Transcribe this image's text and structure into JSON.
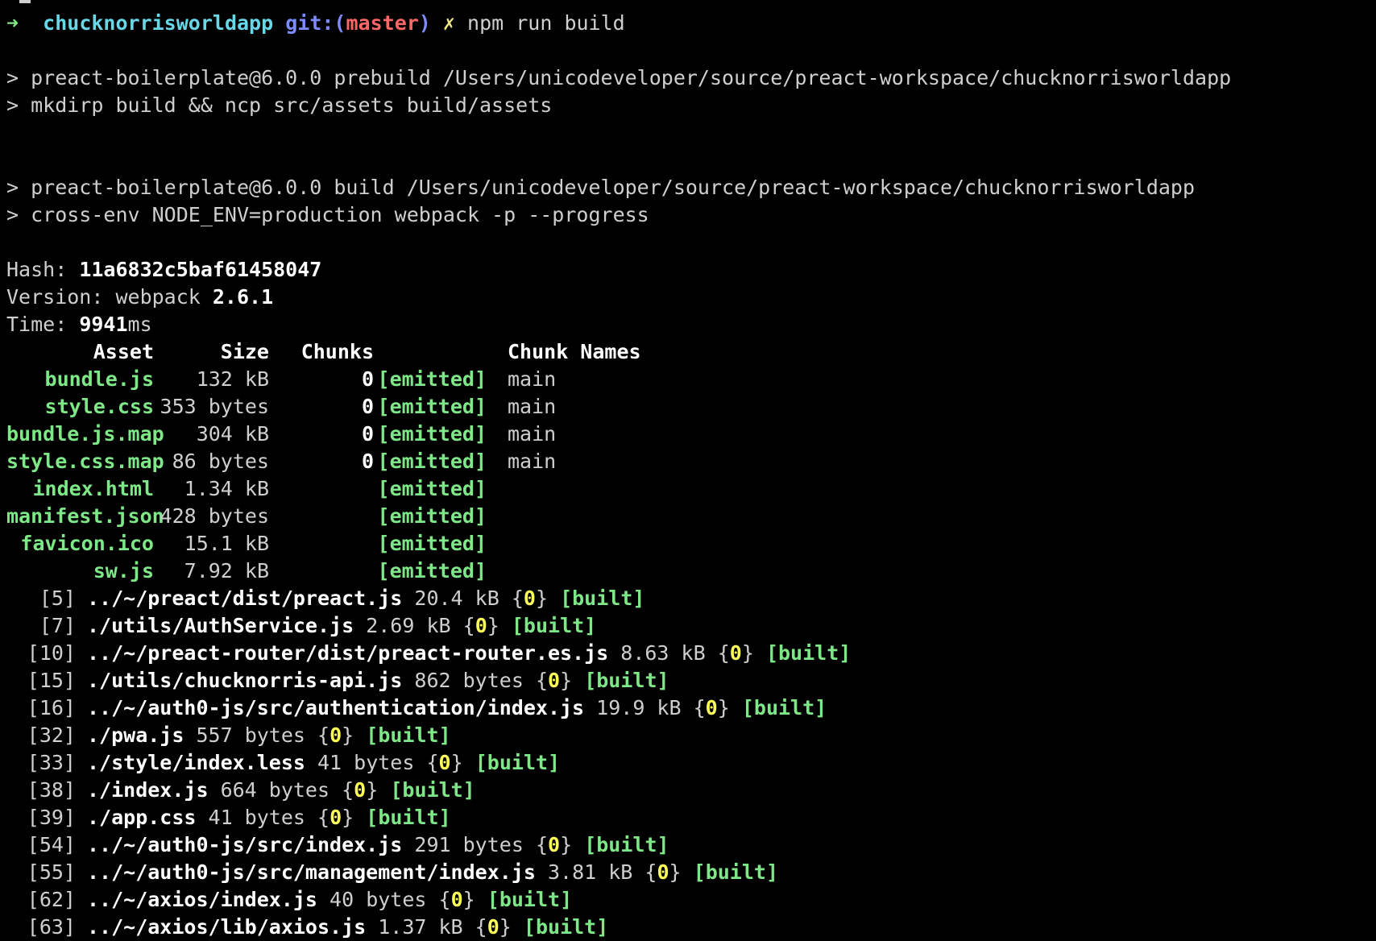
{
  "prompt": {
    "arrow": "➜",
    "dir": "chucknorrisworldapp",
    "git_label": "git:(",
    "branch": "master",
    "git_close": ")",
    "dirty": "✗",
    "command": "npm run build"
  },
  "script_lines": [
    "> preact-boilerplate@6.0.0 prebuild /Users/unicodeveloper/source/preact-workspace/chucknorrisworldapp",
    "> mkdirp build && ncp src/assets build/assets",
    "> preact-boilerplate@6.0.0 build /Users/unicodeveloper/source/preact-workspace/chucknorrisworldapp",
    "> cross-env NODE_ENV=production webpack -p --progress"
  ],
  "stats": {
    "hash_label": "Hash: ",
    "hash": "11a6832c5baf61458047",
    "version_label": "Version: webpack ",
    "version": "2.6.1",
    "time_label": "Time: ",
    "time": "9941",
    "time_unit": "ms"
  },
  "assets_table": {
    "headers": {
      "asset": "Asset",
      "size": "Size",
      "chunks": "Chunks",
      "chunk_names": "Chunk Names"
    },
    "rows": [
      {
        "asset": "bundle.js",
        "size": "132 kB",
        "chunks": "0",
        "status": "[emitted]",
        "names": "main"
      },
      {
        "asset": "style.css",
        "size": "353 bytes",
        "chunks": "0",
        "status": "[emitted]",
        "names": "main"
      },
      {
        "asset": "bundle.js.map",
        "size": "304 kB",
        "chunks": "0",
        "status": "[emitted]",
        "names": "main"
      },
      {
        "asset": "style.css.map",
        "size": "86 bytes",
        "chunks": "0",
        "status": "[emitted]",
        "names": "main"
      },
      {
        "asset": "index.html",
        "size": "1.34 kB",
        "chunks": "",
        "status": "[emitted]",
        "names": ""
      },
      {
        "asset": "manifest.json",
        "size": "428 bytes",
        "chunks": "",
        "status": "[emitted]",
        "names": ""
      },
      {
        "asset": "favicon.ico",
        "size": "15.1 kB",
        "chunks": "",
        "status": "[emitted]",
        "names": ""
      },
      {
        "asset": "sw.js",
        "size": "7.92 kB",
        "chunks": "",
        "status": "[emitted]",
        "names": ""
      }
    ]
  },
  "modules": [
    {
      "id": "[5]",
      "path": "../~/preact/dist/preact.js",
      "size": "20.4 kB",
      "chunk": "0",
      "status": "[built]"
    },
    {
      "id": "[7]",
      "path": "./utils/AuthService.js",
      "size": "2.69 kB",
      "chunk": "0",
      "status": "[built]"
    },
    {
      "id": "[10]",
      "path": "../~/preact-router/dist/preact-router.es.js",
      "size": "8.63 kB",
      "chunk": "0",
      "status": "[built]"
    },
    {
      "id": "[15]",
      "path": "./utils/chucknorris-api.js",
      "size": "862 bytes",
      "chunk": "0",
      "status": "[built]"
    },
    {
      "id": "[16]",
      "path": "../~/auth0-js/src/authentication/index.js",
      "size": "19.9 kB",
      "chunk": "0",
      "status": "[built]"
    },
    {
      "id": "[32]",
      "path": "./pwa.js",
      "size": "557 bytes",
      "chunk": "0",
      "status": "[built]"
    },
    {
      "id": "[33]",
      "path": "./style/index.less",
      "size": "41 bytes",
      "chunk": "0",
      "status": "[built]"
    },
    {
      "id": "[38]",
      "path": "./index.js",
      "size": "664 bytes",
      "chunk": "0",
      "status": "[built]"
    },
    {
      "id": "[39]",
      "path": "./app.css",
      "size": "41 bytes",
      "chunk": "0",
      "status": "[built]"
    },
    {
      "id": "[54]",
      "path": "../~/auth0-js/src/index.js",
      "size": "291 bytes",
      "chunk": "0",
      "status": "[built]"
    },
    {
      "id": "[55]",
      "path": "../~/auth0-js/src/management/index.js",
      "size": "3.81 kB",
      "chunk": "0",
      "status": "[built]"
    },
    {
      "id": "[62]",
      "path": "../~/axios/index.js",
      "size": "40 bytes",
      "chunk": "0",
      "status": "[built]"
    },
    {
      "id": "[63]",
      "path": "../~/axios/lib/axios.js",
      "size": "1.37 kB",
      "chunk": "0",
      "status": "[built]"
    }
  ]
}
